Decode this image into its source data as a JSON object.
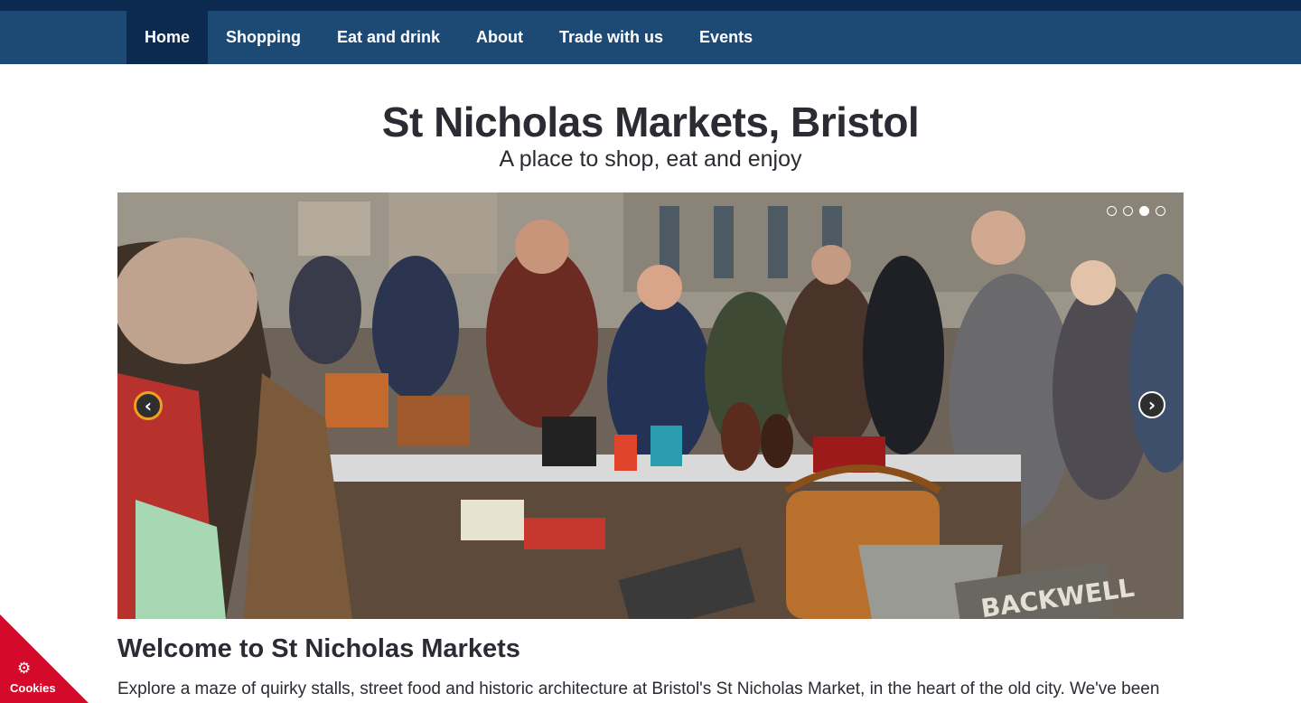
{
  "nav": {
    "items": [
      {
        "label": "Home",
        "active": true
      },
      {
        "label": "Shopping",
        "active": false
      },
      {
        "label": "Eat and drink",
        "active": false
      },
      {
        "label": "About",
        "active": false
      },
      {
        "label": "Trade with us",
        "active": false
      },
      {
        "label": "Events",
        "active": false
      }
    ]
  },
  "header": {
    "title": "St Nicholas Markets, Bristol",
    "tagline": "A place to shop, eat and enjoy"
  },
  "carousel": {
    "slide_count": 4,
    "active_slide": 3,
    "sign_text": "BACKWELL",
    "prev_icon": "chevron-left-icon",
    "next_icon": "chevron-right-icon"
  },
  "main": {
    "heading": "Welcome to St Nicholas Markets",
    "intro": "Explore a maze of quirky stalls, street food and historic architecture at Bristol's St Nicholas Market, in the heart of the old city. We've been"
  },
  "cookie_tab": {
    "label": "Cookies",
    "icon": "gear-icon"
  },
  "colors": {
    "top_strip": "#0c2a4f",
    "nav_bg": "#1d4a75",
    "nav_active": "#0c2a4f",
    "cookie_bg": "#d50a2a",
    "text": "#2b2b33"
  }
}
